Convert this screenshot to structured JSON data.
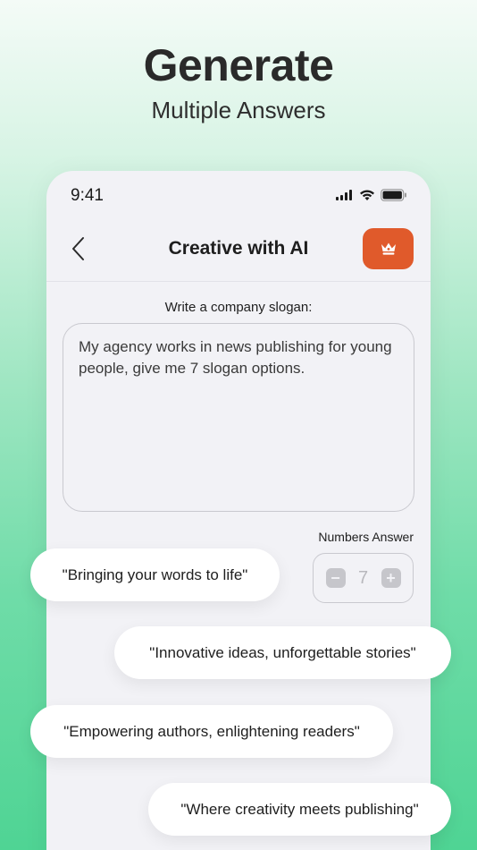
{
  "hero": {
    "title": "Generate",
    "subtitle": "Multiple Answers"
  },
  "status_bar": {
    "time": "9:41",
    "icons": [
      "signal-icon",
      "wifi-icon",
      "battery-icon"
    ]
  },
  "nav": {
    "back_icon": "chevron-left-icon",
    "title": "Creative with AI",
    "premium_icon": "crown-icon",
    "premium_color": "#e05a2b"
  },
  "form": {
    "label": "Write a company slogan:",
    "prompt_value": "My agency works in news publishing for young people, give me 7 slogan options."
  },
  "numbers_answer": {
    "label": "Numbers Answer",
    "value": "7",
    "minus_icon": "minus-icon",
    "plus_icon": "plus-icon"
  },
  "answers": [
    "\"Bringing your words to life\"",
    "\"Innovative ideas, unforgettable stories\"",
    "\"Empowering authors, enlightening readers\"",
    "\"Where creativity meets publishing\""
  ]
}
